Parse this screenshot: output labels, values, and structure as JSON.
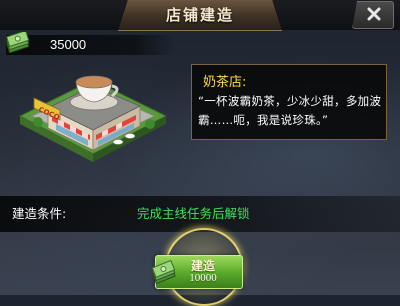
{
  "dialog": {
    "title": "店铺建造",
    "close_icon": "close-x-icon"
  },
  "wallet": {
    "icon": "cash-stack-icon",
    "balance": "35000"
  },
  "shop": {
    "icon": "coco-tea-shop-building",
    "name": "奶茶店:",
    "description": "“一杯波霸奶茶，少冰少甜，多加波霸……呃，我是说珍珠。”"
  },
  "condition": {
    "label": "建造条件:",
    "value": "完成主线任务后解锁"
  },
  "build": {
    "label": "建造",
    "cost": "10000",
    "icon": "cash-stack-icon"
  },
  "colors": {
    "title_text": "#f5e8cf",
    "desc_title": "#ffd94a",
    "condition_value": "#3fe05a",
    "button_green": "#57a82a"
  }
}
